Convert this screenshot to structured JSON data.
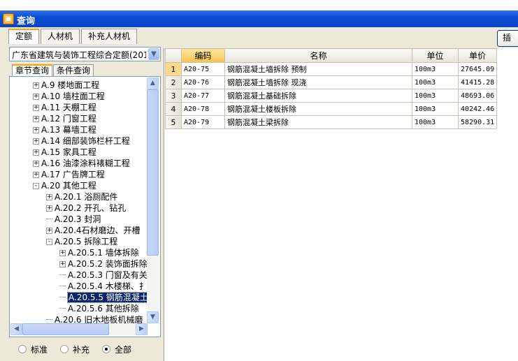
{
  "titlebar": {
    "icon": "app-icon",
    "icon_glyph": "▣",
    "title": "查询"
  },
  "tabs": [
    {
      "label": "定额",
      "active": true
    },
    {
      "label": "人材机",
      "active": false
    },
    {
      "label": "补充人材机",
      "active": false
    }
  ],
  "insert_button": "插",
  "combo": {
    "value": "广东省建筑与装饰工程综合定额(201",
    "arrow": "▼"
  },
  "subtabs": [
    {
      "label": "章节查询",
      "active": true
    },
    {
      "label": "条件查询",
      "active": false
    }
  ],
  "tree": [
    {
      "label": "A.9 楼地面工程",
      "toggle": "+"
    },
    {
      "label": "A.10 墙柱面工程",
      "toggle": "+"
    },
    {
      "label": "A.11 天棚工程",
      "toggle": "+"
    },
    {
      "label": "A.12 门窗工程",
      "toggle": "+"
    },
    {
      "label": "A.13 幕墙工程",
      "toggle": "+"
    },
    {
      "label": "A.14 细部装饰栏杆工程",
      "toggle": "+"
    },
    {
      "label": "A.15 家具工程",
      "toggle": "+"
    },
    {
      "label": "A.16 油漆涂料裱糊工程",
      "toggle": "+"
    },
    {
      "label": "A.17 广告牌工程",
      "toggle": "+"
    },
    {
      "label": "A.20 其他工程",
      "toggle": "-"
    },
    {
      "label": "A.20.1 浴厕配件",
      "toggle": "+"
    },
    {
      "label": "A.20.2 开孔、钻孔",
      "toggle": "+"
    },
    {
      "label": "A.20.3 封洞",
      "toggle": ""
    },
    {
      "label": "A.20.4石材磨边、开槽",
      "toggle": "+"
    },
    {
      "label": "A.20.5 拆除工程",
      "toggle": "-"
    },
    {
      "label": "A.20.5.1 墙体拆除",
      "toggle": "+"
    },
    {
      "label": "A.20.5.2 装饰面拆除",
      "toggle": "+"
    },
    {
      "label": "A.20.5.3 门窗及有关",
      "toggle": ""
    },
    {
      "label": "A.20.5.4 木楼梯、扌",
      "toggle": ""
    },
    {
      "label": "A.20.5.5 钢筋混凝土",
      "toggle": "",
      "selected": true
    },
    {
      "label": "A.20.5.6 其他拆除",
      "toggle": ""
    },
    {
      "label": "A.20.6 旧木地板机械磨",
      "toggle": ""
    }
  ],
  "scroll_arrows": {
    "up": "▲",
    "down": "▼",
    "left": "◀",
    "right": "▶"
  },
  "radios": [
    {
      "label": "标准",
      "checked": false
    },
    {
      "label": "补充",
      "checked": false
    },
    {
      "label": "全部",
      "checked": true
    }
  ],
  "grid": {
    "columns": [
      "",
      "编码",
      "名称",
      "单位",
      "单价"
    ],
    "rows": [
      {
        "n": "1",
        "code": "A20-75",
        "name": "钢筋混凝土墙拆除 预制",
        "unit": "100m3",
        "price": "27645.09"
      },
      {
        "n": "2",
        "code": "A20-76",
        "name": "钢筋混凝土墙拆除 现浇",
        "unit": "100m3",
        "price": "41415.28"
      },
      {
        "n": "3",
        "code": "A20-77",
        "name": "钢筋混凝土基础拆除",
        "unit": "100m3",
        "price": "48693.06"
      },
      {
        "n": "4",
        "code": "A20-78",
        "name": "钢筋混凝土楼板拆除",
        "unit": "100m3",
        "price": "40242.46"
      },
      {
        "n": "5",
        "code": "A20-79",
        "name": "钢筋混凝土梁拆除",
        "unit": "100m3",
        "price": "58290.31"
      }
    ]
  }
}
